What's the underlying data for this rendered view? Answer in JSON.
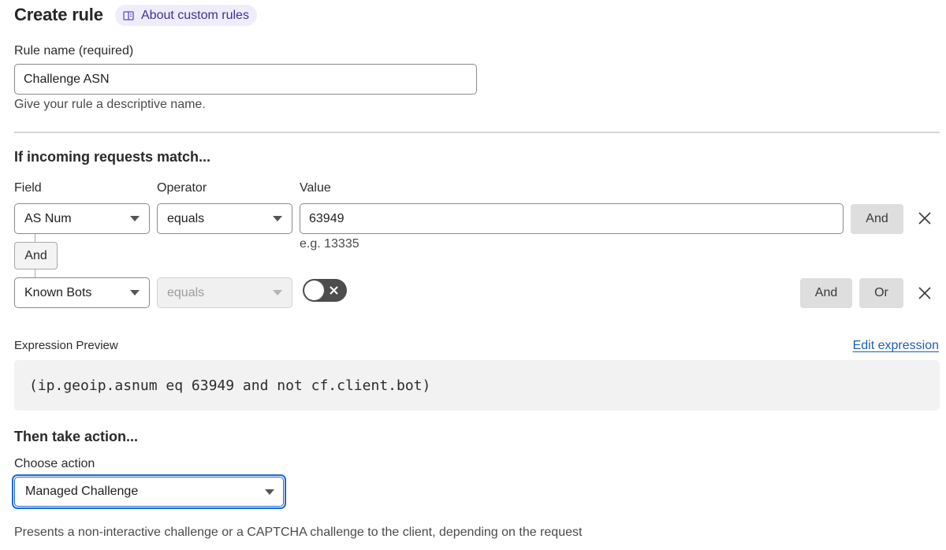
{
  "header": {
    "title": "Create rule",
    "doc_link": {
      "label": "About custom rules",
      "icon": "book-icon",
      "color": "#3b2f9e",
      "bg": "#efedfb"
    }
  },
  "rule_name": {
    "label": "Rule name (required)",
    "value": "Challenge ASN",
    "hint": "Give your rule a descriptive name."
  },
  "match": {
    "title": "If incoming requests match...",
    "columns": {
      "field": "Field",
      "operator": "Operator",
      "value": "Value"
    },
    "rows": [
      {
        "field": "AS Num",
        "operator": "equals",
        "value": "63949",
        "value_hint": "e.g. 13335",
        "buttons": [
          "And"
        ]
      },
      {
        "field": "Known Bots",
        "operator": "equals",
        "operator_disabled": true,
        "toggle": {
          "on": false,
          "icon": "x-icon"
        },
        "buttons": [
          "And",
          "Or"
        ]
      }
    ],
    "connector_label": "And"
  },
  "expression": {
    "label": "Expression Preview",
    "edit_label": "Edit expression",
    "text": "(ip.geoip.asnum eq 63949 and not cf.client.bot)"
  },
  "action": {
    "title": "Then take action...",
    "label": "Choose action",
    "selected": "Managed Challenge",
    "description": "Presents a non-interactive challenge or a CAPTCHA challenge to the client, depending on the request",
    "focus_color": "#1a6ad6"
  },
  "colors": {
    "link": "#1e5fb3",
    "toggle_off": "#4d4d4d"
  }
}
